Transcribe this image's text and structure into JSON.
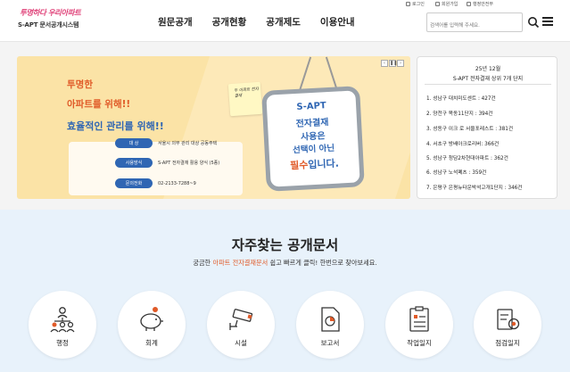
{
  "header": {
    "util_links": [
      "로그인",
      "회원가입",
      "행정안전부"
    ],
    "logo": {
      "slogan": "투명하다 우리아파트",
      "name": "S-APT 문서공개시스템"
    },
    "nav": [
      "원문공개",
      "공개현황",
      "공개제도",
      "이용안내"
    ],
    "search": {
      "placeholder": "검색어를 입력해 주세요."
    }
  },
  "banner": {
    "headline1": "투명한",
    "headline2": "아파트를 위해!!",
    "headline3": "효율적인 관리를 위해!!",
    "sticky_note": "두 아파트 전자결재",
    "rows": [
      {
        "label": "대    상",
        "value": "서울시 의무 관리 대상 공동주택"
      },
      {
        "label": "사용방식",
        "value": "S-APT 전자결재 활용 양식 (5종)"
      },
      {
        "label": "문의전화",
        "value": "02-2133-7288~9"
      }
    ],
    "card_lines": [
      "S-APT",
      "전자결재",
      "사용은",
      "선택이 아닌"
    ],
    "card_highlight": "필수",
    "card_tail": "입니다.",
    "controls": [
      "‹",
      "❚❚",
      "›"
    ]
  },
  "ranking": {
    "title1": "25년 12월",
    "title2": "S-APT 전자결재 상위 7개 단지",
    "items": [
      "1. 성남구 대치미도센트 : 427건",
      "2. 양천구 목동11단지 : 394건",
      "3. 성동구 이크 로 서울포레스트 : 381건",
      "4. 서초구 방배아크로리버: 366건",
      "5. 성남구 청담2차현대아파트 : 362건",
      "6. 성남구 노석폐츠 : 359건",
      "7. 은평구 은평뉴타운박석고개1단지 : 346건"
    ]
  },
  "faq": {
    "title": "자주찾는 공개문서",
    "subtitle_pre": "궁금한 ",
    "subtitle_hl": "아파트 전자결재문서",
    "subtitle_post": " 쉽고 빠르게 클릭! 한번으로 찾아보세요.",
    "categories": [
      {
        "label": "행정",
        "icon": "org-chart-icon"
      },
      {
        "label": "회계",
        "icon": "piggy-bank-icon"
      },
      {
        "label": "시설",
        "icon": "cctv-icon"
      },
      {
        "label": "보고서",
        "icon": "report-icon"
      },
      {
        "label": "작업일지",
        "icon": "work-log-icon"
      },
      {
        "label": "점검일지",
        "icon": "inspection-icon"
      }
    ]
  },
  "colors": {
    "accent_orange": "#e05a28",
    "accent_blue": "#2f66b3",
    "faq_bg": "#e8f2fb",
    "banner_bg": "#fbe3a6"
  }
}
